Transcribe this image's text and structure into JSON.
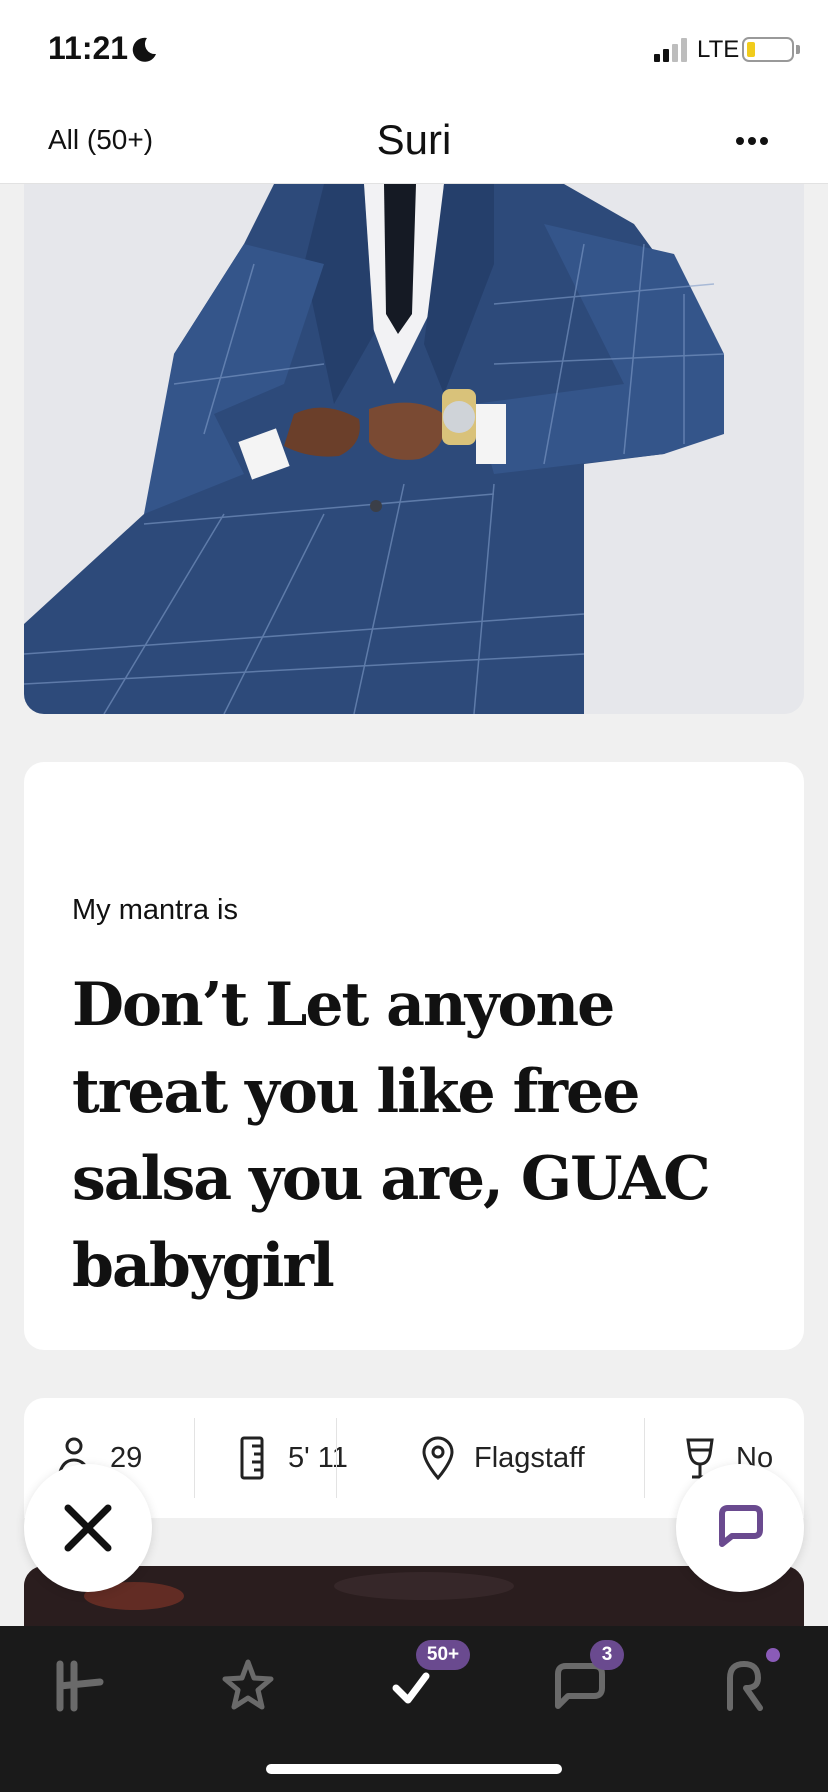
{
  "status_bar": {
    "time": "11:21",
    "network": "LTE",
    "icons": [
      "moon-icon",
      "signal-icon",
      "battery-icon"
    ]
  },
  "header": {
    "back_label": "All (50+)",
    "title": "Suri",
    "more_icon": "more-options-icon"
  },
  "prompt": {
    "question": "My mantra is",
    "answer": "Don’t Let anyone treat you like free salsa you are, GUAC babygirl"
  },
  "details": {
    "age": "29",
    "height": "5' 11",
    "location": "Flagstaff",
    "drinking": "No"
  },
  "tab_bar": {
    "likes_badge": "50+",
    "matches_badge": "3",
    "icons": [
      "hinge-home-icon",
      "star-icon",
      "like-icon",
      "chat-icon",
      "profile-icon"
    ]
  },
  "colors": {
    "accent_purple": "#6a4a8f",
    "tab_bar_bg": "#1a1a1a",
    "battery_fill": "#f1cc1c"
  }
}
